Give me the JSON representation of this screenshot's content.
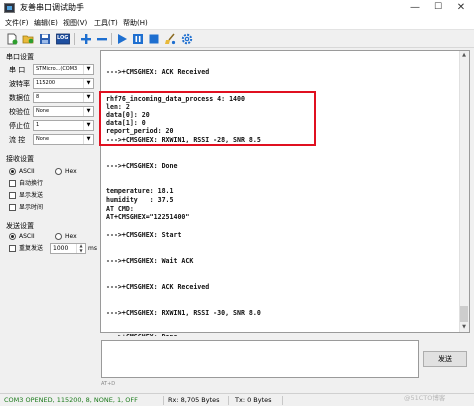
{
  "window": {
    "title": "友善串口调试助手",
    "minimize": "—",
    "maximize": "☐",
    "close": "✕"
  },
  "menu": [
    "文件(F)",
    "编辑(E)",
    "视图(V)",
    "工具(T)",
    "帮助(H)"
  ],
  "toolbar": {
    "icons": [
      "new-file-icon",
      "open-folder-icon",
      "save-icon",
      "log-icon",
      "add-icon",
      "remove-icon",
      "play-icon",
      "pause-icon",
      "stop-icon",
      "clear-brush-icon",
      "settings-gear-icon"
    ],
    "log_label": "LOG"
  },
  "serial_settings": {
    "title": "串口设置",
    "rows": [
      {
        "label": "串  口",
        "value": "STMicro...(COM3"
      },
      {
        "label": "波特率",
        "value": "115200"
      },
      {
        "label": "数据位",
        "value": "8"
      },
      {
        "label": "校验位",
        "value": "None"
      },
      {
        "label": "停止位",
        "value": "1"
      },
      {
        "label": "流  控",
        "value": "None"
      }
    ]
  },
  "receive_settings": {
    "title": "接收设置",
    "mode_ascii": "ASCII",
    "mode_hex": "Hex",
    "selected_mode": "ASCII",
    "options": [
      {
        "label": "自动换行",
        "checked": false
      },
      {
        "label": "显示发送",
        "checked": false
      },
      {
        "label": "显示时间",
        "checked": false
      }
    ]
  },
  "send_settings": {
    "title": "发送设置",
    "mode_ascii": "ASCII",
    "mode_hex": "Hex",
    "selected_mode": "ASCII",
    "repeat_label": "重复发送",
    "repeat_checked": false,
    "interval_value": "1000",
    "interval_unit": "ms"
  },
  "receive_area": {
    "lines": [
      "--->+CMSGHEX: ACK Received",
      "rhf76_incoming_data_process 4: 1400",
      "len: 2",
      "data[0]: 20",
      "data[1]: 0",
      "report_period: 20",
      "--->+CMSGHEX: RXWIN1, RSSI -28, SNR 8.5",
      "--->+CMSGHEX: Done",
      "temperature: 18.1",
      "humidity   : 37.5",
      "AT CMD:",
      "AT+CMSGHEX=\"12251400\"",
      "--->+CMSGHEX: Start",
      "--->+CMSGHEX: Wait ACK",
      "--->+CMSGHEX: ACK Received",
      "--->+CMSGHEX: RXWIN1, RSSI -30, SNR 8.0",
      "--->+CMSGHEX: Done"
    ]
  },
  "send_area": {
    "value": "",
    "send_button": "发送",
    "hscroll_text": "AT+D"
  },
  "status_bar": {
    "port_status": "COM3 OPENED, 115200, 8, NONE, 1, OFF",
    "rx": "Rx: 8,705 Bytes",
    "tx": "Tx: 0 Bytes",
    "watermark": "@51CTO博客"
  },
  "colors": {
    "highlight_border": "#e01020",
    "toolbar_blue": "#1e6fd0",
    "port_status_text": "#1a7a1a"
  }
}
